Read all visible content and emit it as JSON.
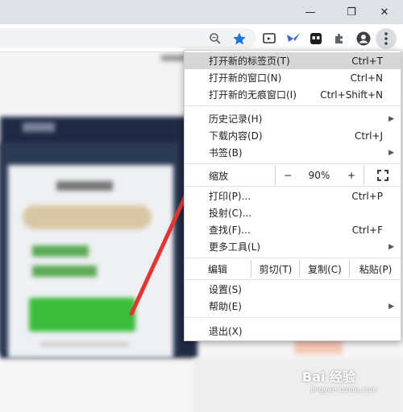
{
  "browser": {
    "window_controls": {
      "minimize": "—",
      "maximize": "❐",
      "close": "✕"
    },
    "toolbar_icons": [
      "zoom-icon",
      "bookmark-star-icon",
      "cast-icon",
      "extension-arrow-icon",
      "extension-face-icon",
      "puzzle-icon",
      "profile-icon",
      "more-menu-icon"
    ],
    "star_color": "#1a73e8"
  },
  "menu": {
    "new_tab": {
      "label": "打开新的标签页(T)",
      "shortcut": "Ctrl+T"
    },
    "new_window": {
      "label": "打开新的窗口(N)",
      "shortcut": "Ctrl+N"
    },
    "new_incognito": {
      "label": "打开新的无痕窗口(I)",
      "shortcut": "Ctrl+Shift+N"
    },
    "history": {
      "label": "历史记录(H)"
    },
    "downloads": {
      "label": "下载内容(D)",
      "shortcut": "Ctrl+J"
    },
    "bookmarks": {
      "label": "书签(B)"
    },
    "zoom": {
      "label": "缩放",
      "minus": "−",
      "value": "90%",
      "plus": "+"
    },
    "print": {
      "label": "打印(P)...",
      "shortcut": "Ctrl+P"
    },
    "cast": {
      "label": "投射(C)..."
    },
    "find": {
      "label": "查找(F)...",
      "shortcut": "Ctrl+F"
    },
    "more_tools": {
      "label": "更多工具(L)"
    },
    "edit": {
      "label": "编辑",
      "cut": "剪切(T)",
      "copy": "复制(C)",
      "paste": "粘贴(P)"
    },
    "settings": {
      "label": "设置(S)"
    },
    "help": {
      "label": "帮助(E)"
    },
    "exit": {
      "label": "退出(X)"
    }
  },
  "watermark": {
    "logo": "Bai 经验",
    "url": "jingyan.baidu.com"
  }
}
